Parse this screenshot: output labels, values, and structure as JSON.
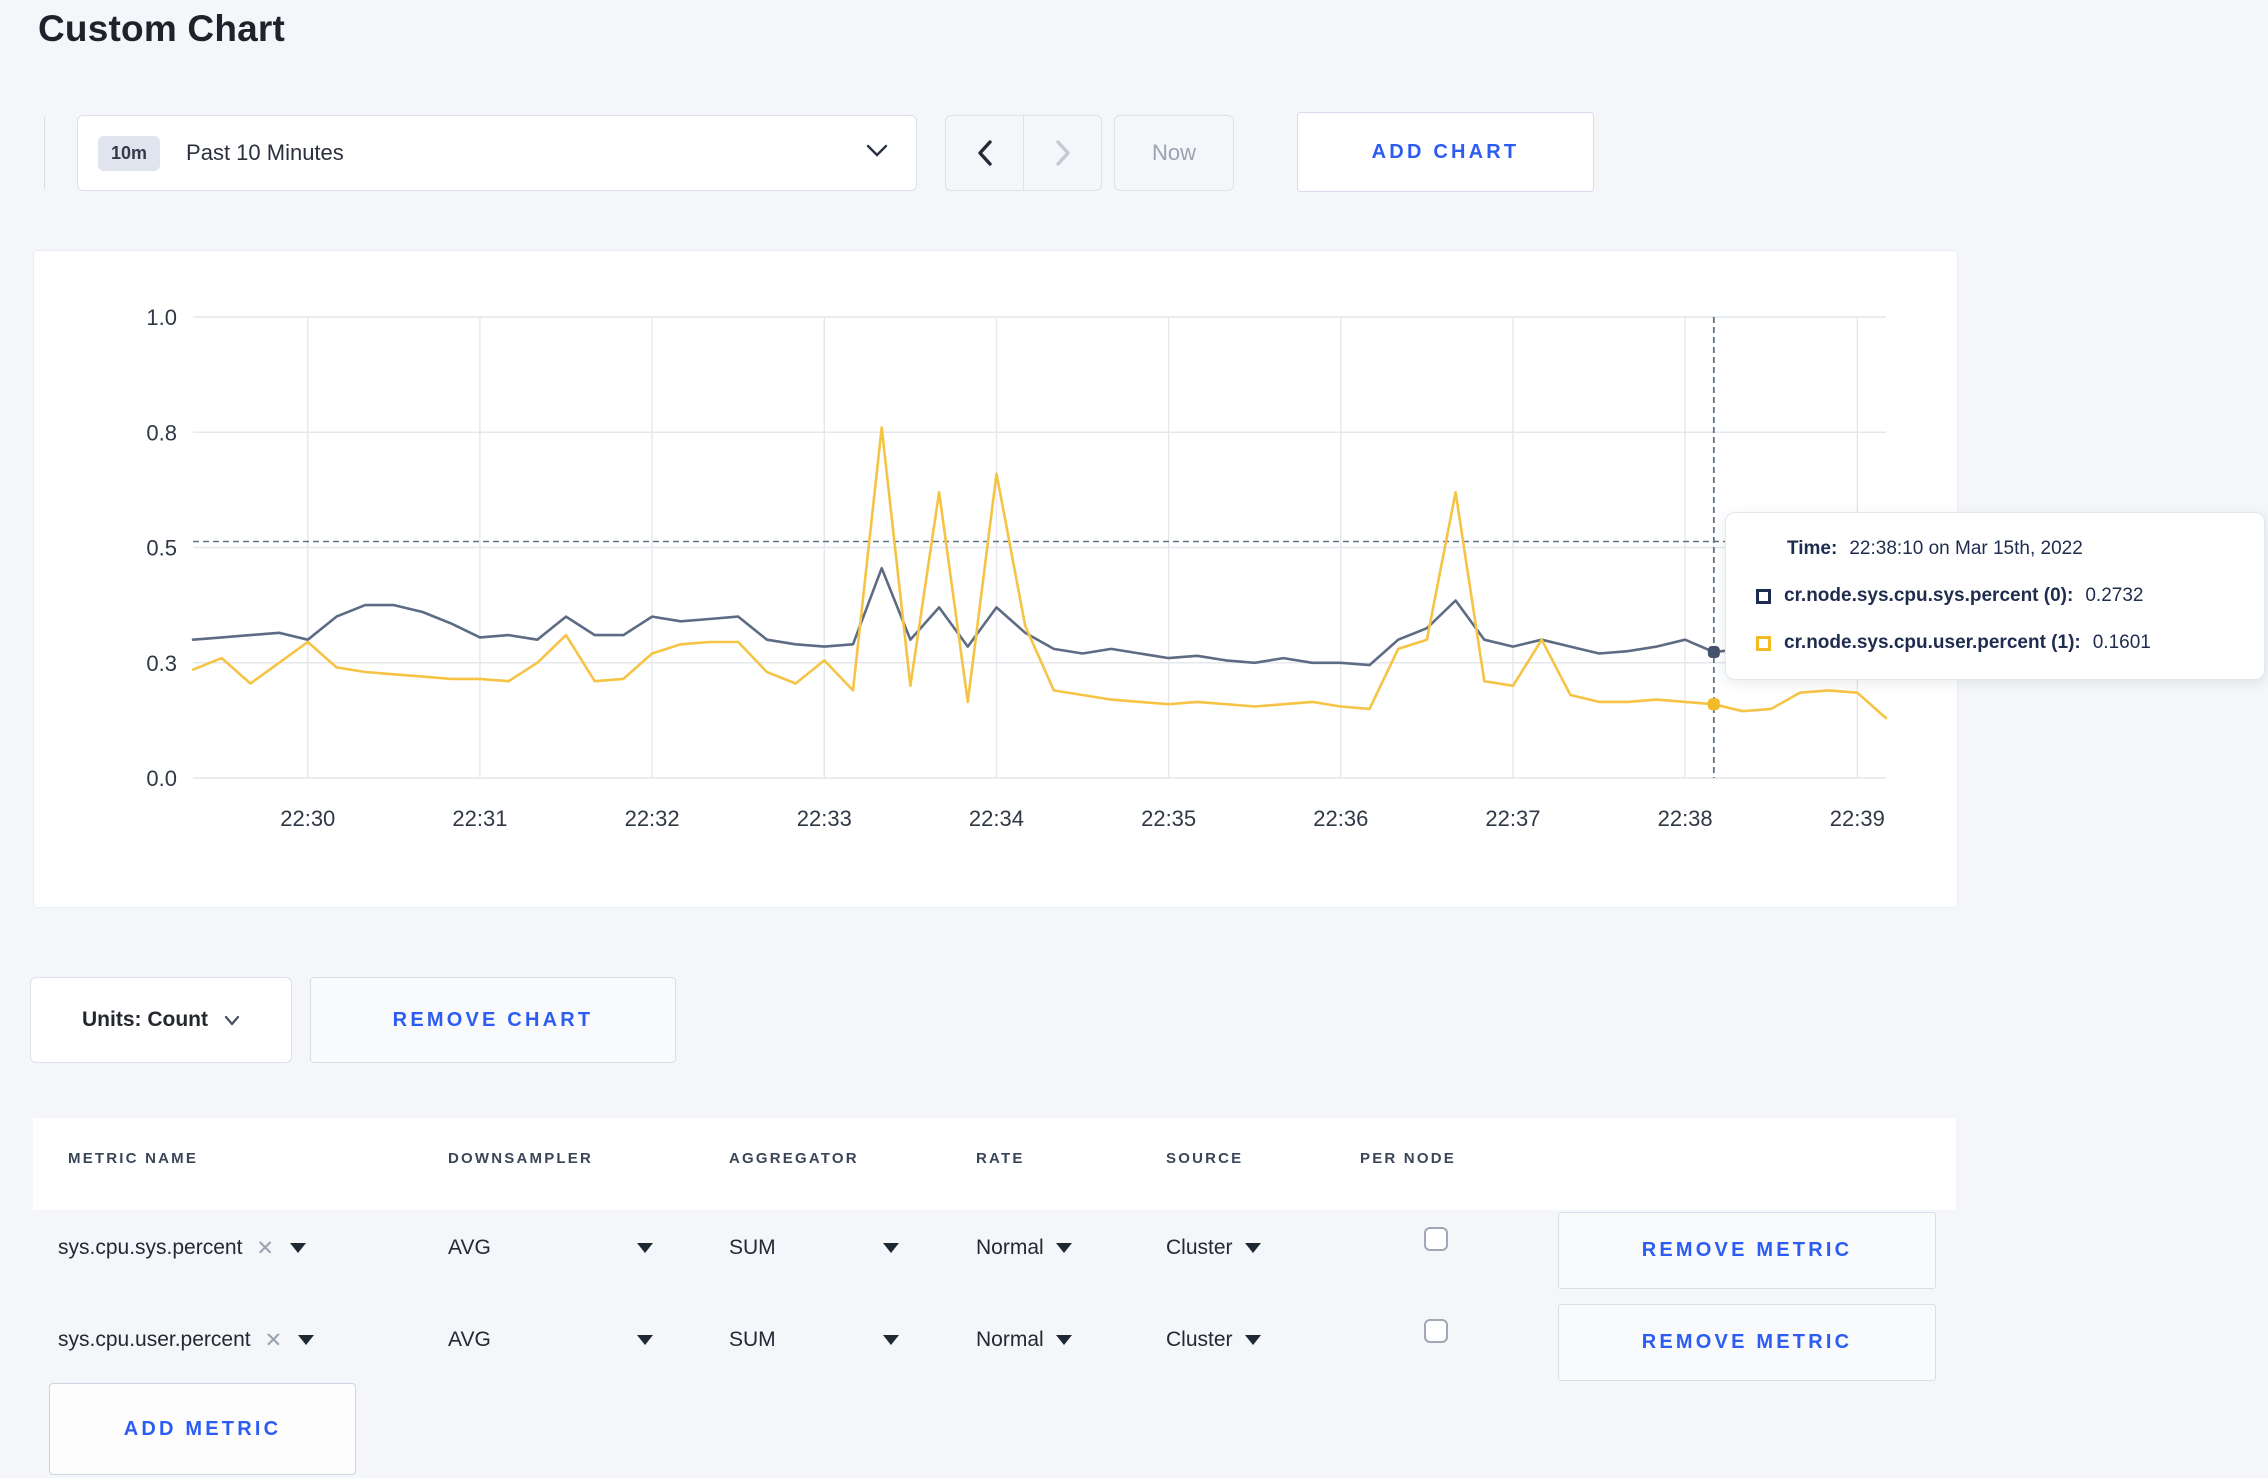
{
  "page": {
    "title": "Custom Chart"
  },
  "toolbar": {
    "time_range": {
      "badge": "10m",
      "label": "Past 10 Minutes"
    },
    "now_label": "Now",
    "add_chart_label": "ADD CHART",
    "prev_icon": "chevron-left",
    "next_icon": "chevron-right"
  },
  "colors": {
    "accent_blue": "#2c5cf2",
    "page_bg": "#f4f6f9",
    "grid": "#e4e7ec",
    "axis_text": "#2f3844",
    "dashed": "#5e7389",
    "series_sys": "#5d6b84",
    "series_user": "#f6c445",
    "marker_sys": "#46536d",
    "marker_user": "#f1ba27"
  },
  "tooltip": {
    "time_label": "Time:",
    "time_value": "22:38:10 on Mar 15th, 2022",
    "series": [
      {
        "label": "cr.node.sys.cpu.sys.percent (0):",
        "value": "0.2732",
        "color": "#1c2b4f"
      },
      {
        "label": "cr.node.sys.cpu.user.percent (1):",
        "value": "0.1601",
        "color": "#f2bb23"
      }
    ]
  },
  "units_bar": {
    "units_label": "Units: Count",
    "remove_chart_label": "REMOVE CHART"
  },
  "metrics_table": {
    "headers": [
      "METRIC NAME",
      "DOWNSAMPLER",
      "AGGREGATOR",
      "RATE",
      "SOURCE",
      "PER NODE"
    ],
    "rows": [
      {
        "name": "sys.cpu.sys.percent",
        "downsampler": "AVG",
        "aggregator": "SUM",
        "rate": "Normal",
        "source": "Cluster",
        "per_node_checked": false,
        "remove_label": "REMOVE METRIC"
      },
      {
        "name": "sys.cpu.user.percent",
        "downsampler": "AVG",
        "aggregator": "SUM",
        "rate": "Normal",
        "source": "Cluster",
        "per_node_checked": false,
        "remove_label": "REMOVE METRIC"
      }
    ],
    "add_metric_label": "ADD METRIC"
  },
  "chart_data": {
    "type": "line",
    "title": "",
    "xlabel": "",
    "ylabel": "",
    "ylim": [
      0,
      1
    ],
    "grid": true,
    "legend_position": "none",
    "x_start_time": "22:29:20",
    "x_step_seconds": 10,
    "x_ticks": [
      {
        "label": "22:30",
        "index": 4
      },
      {
        "label": "22:31",
        "index": 10
      },
      {
        "label": "22:32",
        "index": 16
      },
      {
        "label": "22:33",
        "index": 22
      },
      {
        "label": "22:34",
        "index": 28
      },
      {
        "label": "22:35",
        "index": 34
      },
      {
        "label": "22:36",
        "index": 40
      },
      {
        "label": "22:37",
        "index": 46
      },
      {
        "label": "22:38",
        "index": 52
      },
      {
        "label": "22:39",
        "index": 58
      }
    ],
    "y_ticks": [
      {
        "value": 0.0,
        "label": "0.0"
      },
      {
        "value": 0.25,
        "label": "0.3"
      },
      {
        "value": 0.5,
        "label": "0.5"
      },
      {
        "value": 0.75,
        "label": "0.8"
      },
      {
        "value": 1.0,
        "label": "1.0"
      }
    ],
    "mean_line_value": 0.513,
    "series": [
      {
        "name": "cr.node.sys.cpu.sys.percent (0)",
        "color": "#5d6b84",
        "values": [
          0.3,
          0.305,
          0.31,
          0.315,
          0.3,
          0.35,
          0.375,
          0.375,
          0.36,
          0.335,
          0.305,
          0.31,
          0.3,
          0.35,
          0.31,
          0.31,
          0.35,
          0.34,
          0.345,
          0.35,
          0.3,
          0.29,
          0.285,
          0.29,
          0.455,
          0.3,
          0.37,
          0.285,
          0.37,
          0.315,
          0.28,
          0.27,
          0.28,
          0.27,
          0.26,
          0.265,
          0.255,
          0.25,
          0.26,
          0.25,
          0.25,
          0.245,
          0.3,
          0.325,
          0.385,
          0.3,
          0.285,
          0.3,
          0.285,
          0.27,
          0.275,
          0.285,
          0.3,
          0.2732,
          0.28,
          0.275,
          0.27,
          0.275,
          0.28,
          0.285
        ]
      },
      {
        "name": "cr.node.sys.cpu.user.percent (1)",
        "color": "#f6c445",
        "values": [
          0.235,
          0.26,
          0.205,
          0.25,
          0.295,
          0.24,
          0.23,
          0.225,
          0.22,
          0.215,
          0.215,
          0.21,
          0.25,
          0.31,
          0.21,
          0.215,
          0.27,
          0.29,
          0.295,
          0.295,
          0.23,
          0.205,
          0.255,
          0.19,
          0.76,
          0.2,
          0.62,
          0.165,
          0.66,
          0.33,
          0.19,
          0.18,
          0.17,
          0.165,
          0.16,
          0.165,
          0.16,
          0.155,
          0.16,
          0.165,
          0.155,
          0.15,
          0.28,
          0.3,
          0.62,
          0.21,
          0.2,
          0.3,
          0.18,
          0.165,
          0.165,
          0.17,
          0.165,
          0.1601,
          0.145,
          0.15,
          0.185,
          0.19,
          0.185,
          0.13
        ]
      }
    ],
    "crosshair": {
      "time": "22:38:10",
      "index": 53,
      "marker_values": [
        0.2732,
        0.1601
      ],
      "marker_colors": [
        "#46536d",
        "#f1ba27"
      ]
    }
  }
}
